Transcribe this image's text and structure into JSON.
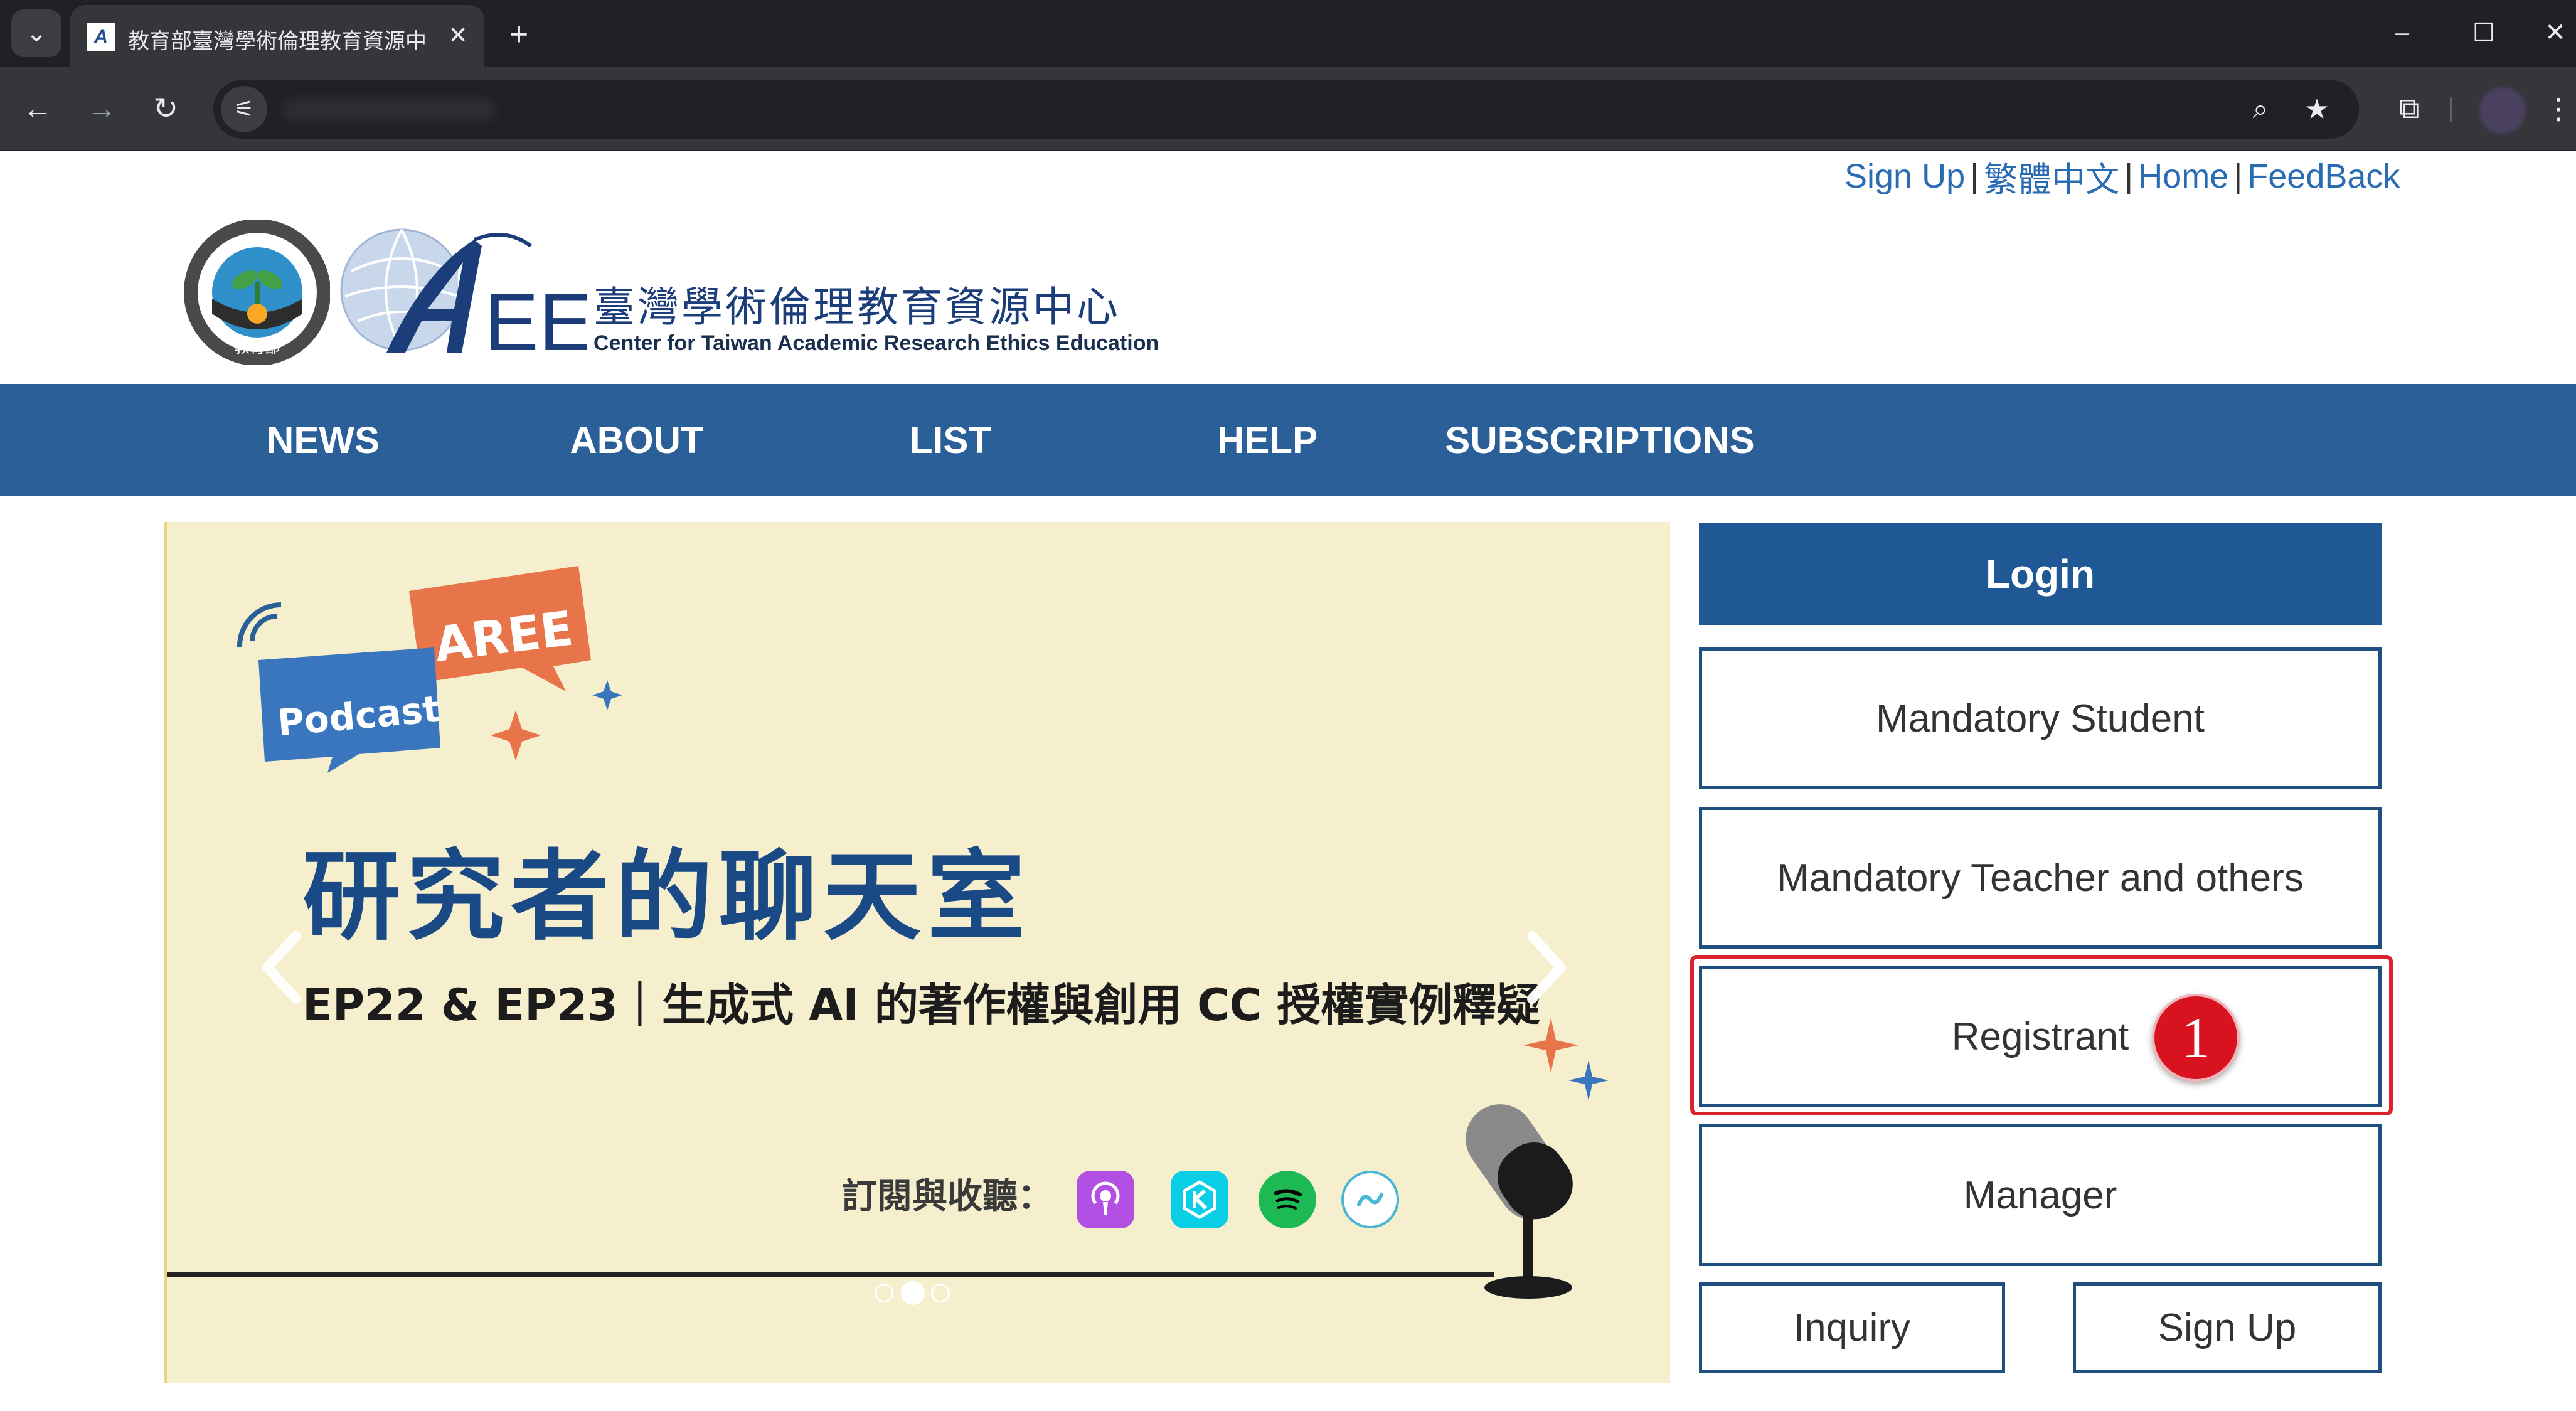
{
  "browser": {
    "tab_title": "教育部臺灣學術倫理教育資源中",
    "favicon_text": "A",
    "close_glyph": "✕",
    "new_tab_glyph": "+",
    "menu_glyph": "⌄",
    "window_minimize": "–",
    "window_maximize": "☐",
    "window_close": "✕",
    "back_glyph": "←",
    "forward_glyph": "→",
    "reload_glyph": "↻",
    "site_info_glyph": "⚟",
    "zoom_glyph": "⌕",
    "bookmark_glyph": "★",
    "extensions_glyph": "⧉",
    "more_glyph": "⋮"
  },
  "top_links": {
    "sign_up": "Sign Up",
    "chinese": "繁體中文",
    "home": "Home",
    "feedback": "FeedBack",
    "separator": "|"
  },
  "logo": {
    "moe_ring_text": "MINISTRY OF EDUCATION",
    "moe_bottom_text": "教育部",
    "aree_letters": "AREE",
    "title_zh": "臺灣學術倫理教育資源中心",
    "title_en": "Center for Taiwan Academic Research Ethics Education"
  },
  "nav": {
    "items": [
      "NEWS",
      "ABOUT",
      "LIST",
      "HELP",
      "SUBSCRIPTIONS"
    ]
  },
  "banner": {
    "badge_aree": "AREE",
    "badge_podcast": "Podcast",
    "title": "研究者的聊天室",
    "subtitle": "EP22 & EP23｜生成式 AI 的著作權與創用 CC 授權實例釋疑",
    "subscribe_label": "訂閱與收聽：",
    "platforms": [
      "apple-podcasts-icon",
      "kkbox-icon",
      "spotify-icon",
      "soundon-icon"
    ],
    "slide_count": 3,
    "active_slide": 2
  },
  "login": {
    "header": "Login",
    "mandatory_student": "Mandatory Student",
    "mandatory_teacher": "Mandatory Teacher and others",
    "registrant": "Registrant",
    "manager": "Manager",
    "inquiry": "Inquiry",
    "sign_up": "Sign Up",
    "step_badge": "1"
  },
  "colors": {
    "nav_blue": "#2a5f98",
    "login_header_blue": "#1f5895",
    "banner_bg": "#f6efce",
    "highlight_red": "#d9232d"
  }
}
